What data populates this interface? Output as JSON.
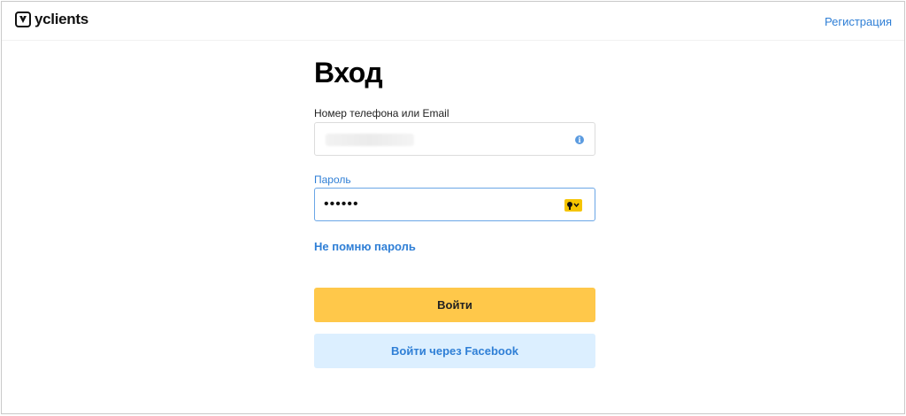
{
  "header": {
    "logo_text": "yclients",
    "register_label": "Регистрация"
  },
  "form": {
    "title": "Вход",
    "login_label": "Номер телефона или Email",
    "login_value": "",
    "password_label": "Пароль",
    "password_mask": "••••••",
    "forgot_label": "Не помню пароль",
    "login_button": "Войти",
    "facebook_button": "Войти через Facebook"
  },
  "colors": {
    "accent_blue": "#2f7fd6",
    "login_button": "#ffc84a",
    "facebook_button_bg": "#dcefff",
    "password_manager_icon": "#f5c400"
  },
  "icons": {
    "logo": "logo-icon",
    "login_field": "info-icon",
    "password_field": "key-icon"
  }
}
